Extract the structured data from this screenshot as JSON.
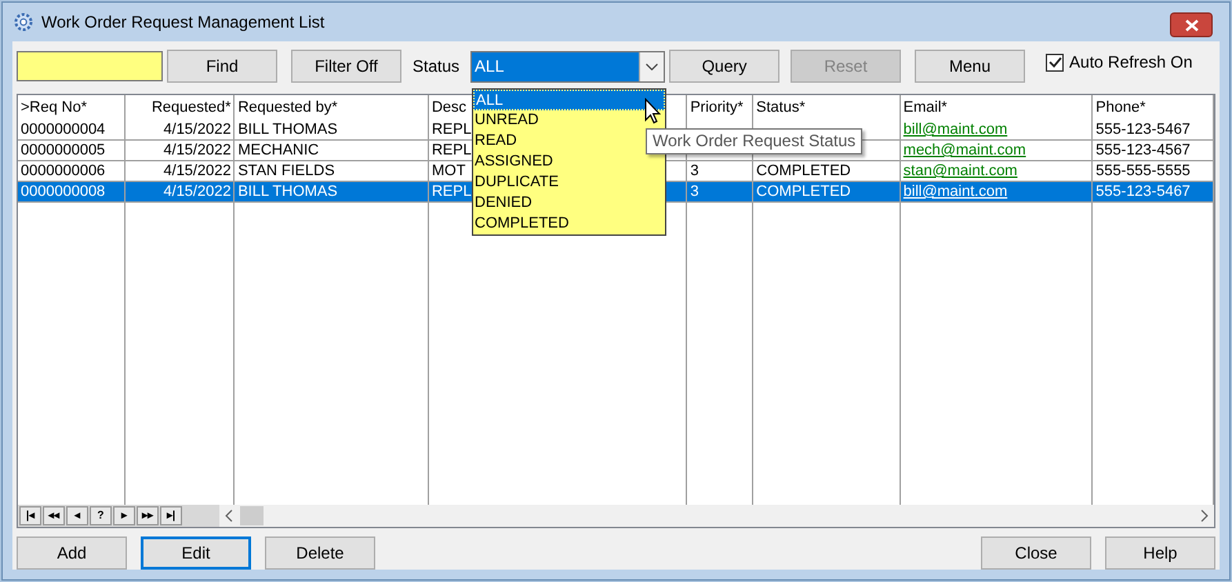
{
  "window": {
    "title": "Work Order Request Management List"
  },
  "toolbar": {
    "find": "Find",
    "filter": "Filter Off",
    "status_label": "Status",
    "status_value": "ALL",
    "query": "Query",
    "reset": {
      "label": "Reset",
      "disabled": true
    },
    "menu": "Menu",
    "auto_refresh": {
      "label": "Auto Refresh On",
      "checked": true
    }
  },
  "status_dropdown": {
    "expanded": true,
    "options": [
      {
        "label": "ALL",
        "selected": true
      },
      {
        "label": "UNREAD",
        "selected": false
      },
      {
        "label": "READ",
        "selected": false
      },
      {
        "label": "ASSIGNED",
        "selected": false
      },
      {
        "label": "DUPLICATE",
        "selected": false
      },
      {
        "label": "DENIED",
        "selected": false
      },
      {
        "label": "COMPLETED",
        "selected": false
      }
    ]
  },
  "tooltip": "Work Order Request Status",
  "table": {
    "columns": [
      ">Req No*",
      "Requested*",
      "Requested by*",
      "Desc",
      "Priority*",
      "Status*",
      "Email*",
      "Phone*"
    ],
    "rows": [
      {
        "selected": false,
        "cells": [
          "0000000004",
          "4/15/2022",
          "BILL THOMAS",
          "REPL",
          null,
          null,
          "bill@maint.com",
          "555-123-5467"
        ]
      },
      {
        "selected": false,
        "cells": [
          "0000000005",
          "4/15/2022",
          "MECHANIC",
          "REPL",
          null,
          null,
          "mech@maint.com",
          "555-123-4567"
        ]
      },
      {
        "selected": false,
        "cells": [
          "0000000006",
          "4/15/2022",
          "STAN FIELDS",
          "MOT",
          "3",
          "COMPLETED",
          "stan@maint.com",
          "555-555-5555"
        ]
      },
      {
        "selected": true,
        "cells": [
          "0000000008",
          "4/15/2022",
          "BILL THOMAS",
          "REPL",
          "3",
          "COMPLETED",
          "bill@maint.com",
          "555-123-5467"
        ]
      }
    ]
  },
  "navigator": [
    "|◂",
    "◂◂",
    "◂",
    "?",
    "▸",
    "▸▸",
    "▸|"
  ],
  "buttons_left": [
    {
      "label": "Add",
      "focused": false
    },
    {
      "label": "Edit",
      "focused": true
    },
    {
      "label": "Delete",
      "focused": false
    }
  ],
  "buttons_right": [
    {
      "label": "Close",
      "focused": false
    },
    {
      "label": "Help",
      "focused": false
    }
  ]
}
